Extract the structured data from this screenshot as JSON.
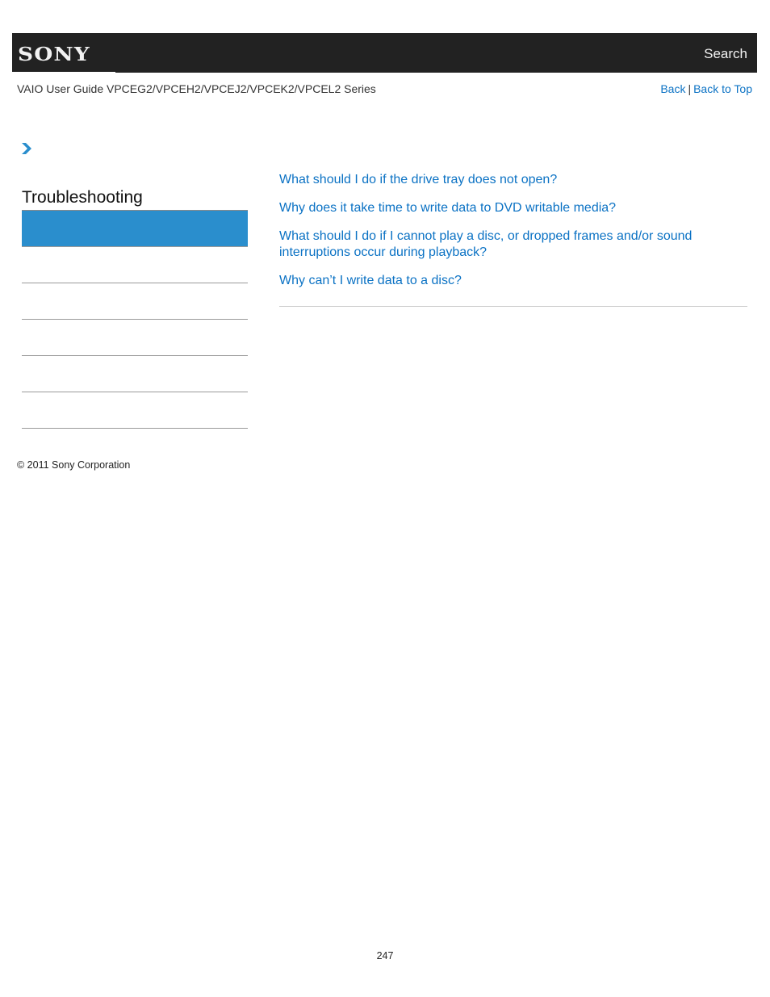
{
  "header": {
    "logo_text": "SONY",
    "search_label": "Search"
  },
  "subheader": {
    "guide_title": "VAIO User Guide VPCEG2/VPCEH2/VPCEJ2/VPCEK2/VPCEL2 Series",
    "back_label": "Back",
    "separator": "|",
    "back_to_top_label": "Back to Top"
  },
  "breadcrumb": {
    "icon": "chevron-right-icon"
  },
  "sidebar": {
    "section_title": "Troubleshooting",
    "items": [
      {
        "label": "",
        "active": true
      },
      {
        "label": "",
        "active": false
      },
      {
        "label": "",
        "active": false
      },
      {
        "label": "",
        "active": false
      },
      {
        "label": "",
        "active": false
      },
      {
        "label": "",
        "active": false
      }
    ],
    "active_color": "#2a8ecd"
  },
  "main": {
    "links": [
      "What should I do if the drive tray does not open?",
      "Why does it take time to write data to DVD writable media?",
      "What should I do if I cannot play a disc, or dropped frames and/or sound interruptions occur during playback?",
      "Why can’t I write data to a disc?"
    ],
    "link_color": "#0b72c4"
  },
  "footer": {
    "copyright": "© 2011 Sony Corporation",
    "page_number": "247"
  }
}
